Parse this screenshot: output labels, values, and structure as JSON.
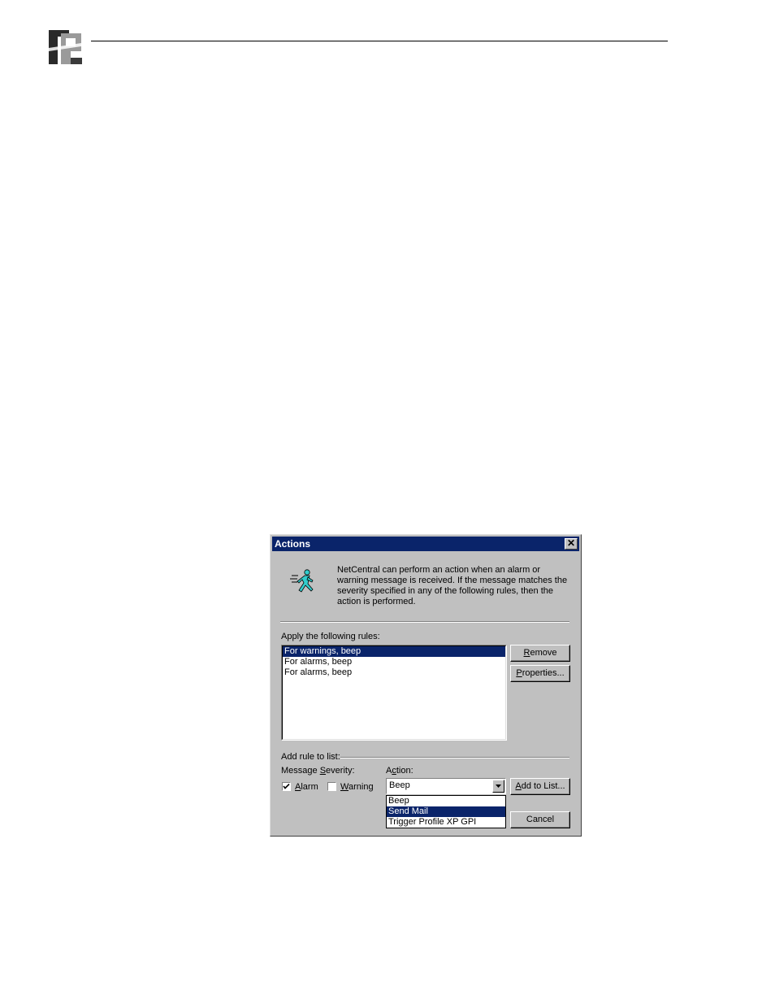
{
  "dialog": {
    "title": "Actions",
    "close_glyph": "✕",
    "intro_text": "NetCentral can perform an action when an alarm or warning message is received. If the message matches the severity specified in any of the following rules, then the action is performed.",
    "rules_label": "Apply the following rules:",
    "rules": [
      {
        "label": "For warnings, beep",
        "selected": true
      },
      {
        "label": "For alarms, beep",
        "selected": false
      },
      {
        "label": "For alarms, beep",
        "selected": false
      }
    ],
    "remove_button": {
      "prefix": "",
      "accel": "R",
      "rest": "emove"
    },
    "properties_button": {
      "prefix": "",
      "accel": "P",
      "rest": "roperties..."
    },
    "add_rule_label": "Add rule to list:",
    "severity_label": {
      "prefix": "Message ",
      "accel": "S",
      "rest": "everity:"
    },
    "alarm_checkbox": {
      "checked": true,
      "prefix": "",
      "accel": "A",
      "rest": "larm"
    },
    "warning_checkbox": {
      "checked": false,
      "prefix": "",
      "accel": "W",
      "rest": "arning"
    },
    "action_label": {
      "prefix": "A",
      "accel": "c",
      "rest": "tion:"
    },
    "action_combo": {
      "value": "Beep",
      "options": [
        "Beep",
        "Send Mail",
        "Trigger Profile XP GPI"
      ],
      "highlighted": "Send Mail"
    },
    "add_to_list_button": {
      "prefix": "",
      "accel": "A",
      "rest": "dd to List..."
    },
    "cancel_button": "Cancel"
  },
  "icons": [
    "logo-icon",
    "running-man-icon",
    "close-icon",
    "checkmark-icon",
    "dropdown-arrow-icon"
  ]
}
